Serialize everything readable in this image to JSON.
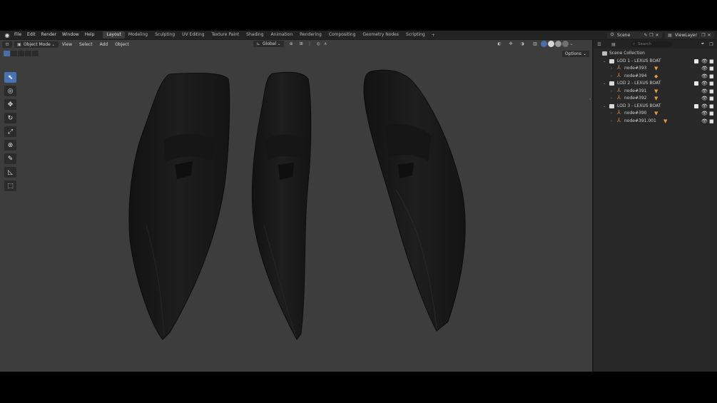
{
  "topbar": {
    "menus": [
      "File",
      "Edit",
      "Render",
      "Window",
      "Help"
    ],
    "workspaces": [
      "Layout",
      "Modeling",
      "Sculpting",
      "UV Editing",
      "Texture Paint",
      "Shading",
      "Animation",
      "Rendering",
      "Compositing",
      "Geometry Nodes",
      "Scripting"
    ],
    "active_workspace": "Layout",
    "scene_label": "Scene",
    "view_layer_label": "ViewLayer"
  },
  "viewport_header": {
    "mode": "Object Mode",
    "menus": [
      "View",
      "Select",
      "Add",
      "Object"
    ],
    "orientation": "Global",
    "options": "Options"
  },
  "outliner": {
    "search_placeholder": "Search",
    "root": "Scene Collection",
    "collections": [
      {
        "name": "LOD 1 - LEXUS BOAT",
        "objects": [
          {
            "name": "node#393"
          },
          {
            "name": "node#394"
          }
        ]
      },
      {
        "name": "LOD 2 - LEXUS BOAT",
        "objects": [
          {
            "name": "node#391"
          },
          {
            "name": "node#392"
          }
        ]
      },
      {
        "name": "LOD 3 - LEXUS BOAT",
        "objects": [
          {
            "name": "node#390"
          },
          {
            "name": "node#391.001"
          }
        ]
      }
    ]
  },
  "colors": {
    "accent": "#4772b3",
    "object_orange": "#e08838",
    "viewport_bg": "#3d3d3d"
  }
}
